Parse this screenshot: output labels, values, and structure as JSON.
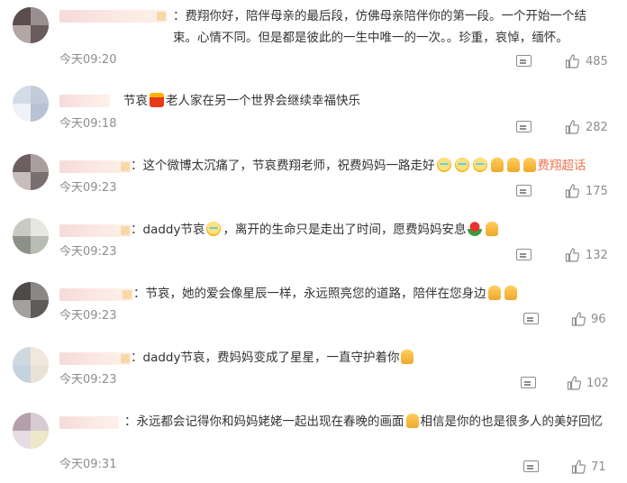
{
  "comments": [
    {
      "text": "：费翔你好，陪伴母亲的最后段，仿佛母亲陪伴你的第一段。一个开始一个结束。心情不同。但是都是彼此的一生中唯一的一次。。珍重，哀悼，缅怀。",
      "time": "今天09:20",
      "likes": "485"
    },
    {
      "text_a": "节哀",
      "emoji_a": "candle-emoji",
      "text_b": "老人家在另一个世界会继续幸福快乐",
      "time": "今天09:18",
      "likes": "282"
    },
    {
      "text_a": "：这个微博太沉痛了，节哀费翔老师，祝费妈妈一路走好",
      "emoji_a": "crying-emoji",
      "emoji_b": "pray-emoji",
      "link": "费翔超话",
      "time": "今天09:23",
      "likes": "175"
    },
    {
      "text_a": "：daddy节哀",
      "emoji_a": "crying-emoji",
      "text_b": "，离开的生命只是走出了时间，愿费妈妈安息",
      "emoji_b": "rose-emoji",
      "emoji_c": "pray-emoji",
      "time": "今天09:23",
      "likes": "132"
    },
    {
      "text_a": "：节哀，她的爱会像星辰一样，永远照亮您的道路，陪伴在您身边",
      "emoji_a": "pray-emoji",
      "time": "今天09:23",
      "likes": "96"
    },
    {
      "text_a": "：daddy节哀，费妈妈变成了星星，一直守护着你",
      "emoji_a": "pray-emoji",
      "time": "今天09:23",
      "likes": "102"
    },
    {
      "text_a": "：永远都会记得你和妈妈姥姥一起出现在春晚的画面",
      "emoji_a": "pray-emoji",
      "text_b": "相信是你的也是很多人的美好回忆",
      "time": "今天09:31",
      "likes": "71"
    }
  ],
  "colors": {
    "text": "#333333",
    "meta": "#8d8d8d",
    "link": "#eb7350"
  }
}
